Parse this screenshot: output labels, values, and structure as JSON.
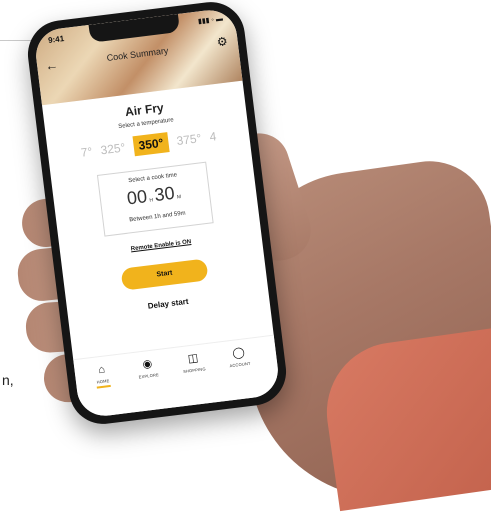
{
  "page": {
    "text_fragment": "n,"
  },
  "status": {
    "time": "9:41",
    "icons": "▮▮▮ ◦ ▬"
  },
  "header": {
    "title": "Cook Summary",
    "back_icon": "arrow-left-icon",
    "settings_icon": "gear-icon"
  },
  "cook": {
    "mode": "Air Fry",
    "temp_label": "Select a temperature",
    "temperatures": [
      "7°",
      "325°",
      "350°",
      "375°",
      "4"
    ],
    "selected_temperature": "350°",
    "time_label": "Select a cook time",
    "hours": "00",
    "hours_unit": "H",
    "minutes": "30",
    "minutes_unit": "M",
    "time_range": "Between 1h and 59m",
    "remote_status": "Remote Enable is ON",
    "start_label": "Start",
    "delay_label": "Delay start"
  },
  "nav": {
    "items": [
      {
        "label": "HOME",
        "icon": "home-icon"
      },
      {
        "label": "EXPLORE",
        "icon": "globe-icon"
      },
      {
        "label": "SHOPPING",
        "icon": "cart-icon"
      },
      {
        "label": "ACCOUNT",
        "icon": "user-icon"
      }
    ]
  },
  "colors": {
    "accent": "#f1b31c",
    "phone_body": "#151515",
    "sleeve": "#d87a63"
  }
}
